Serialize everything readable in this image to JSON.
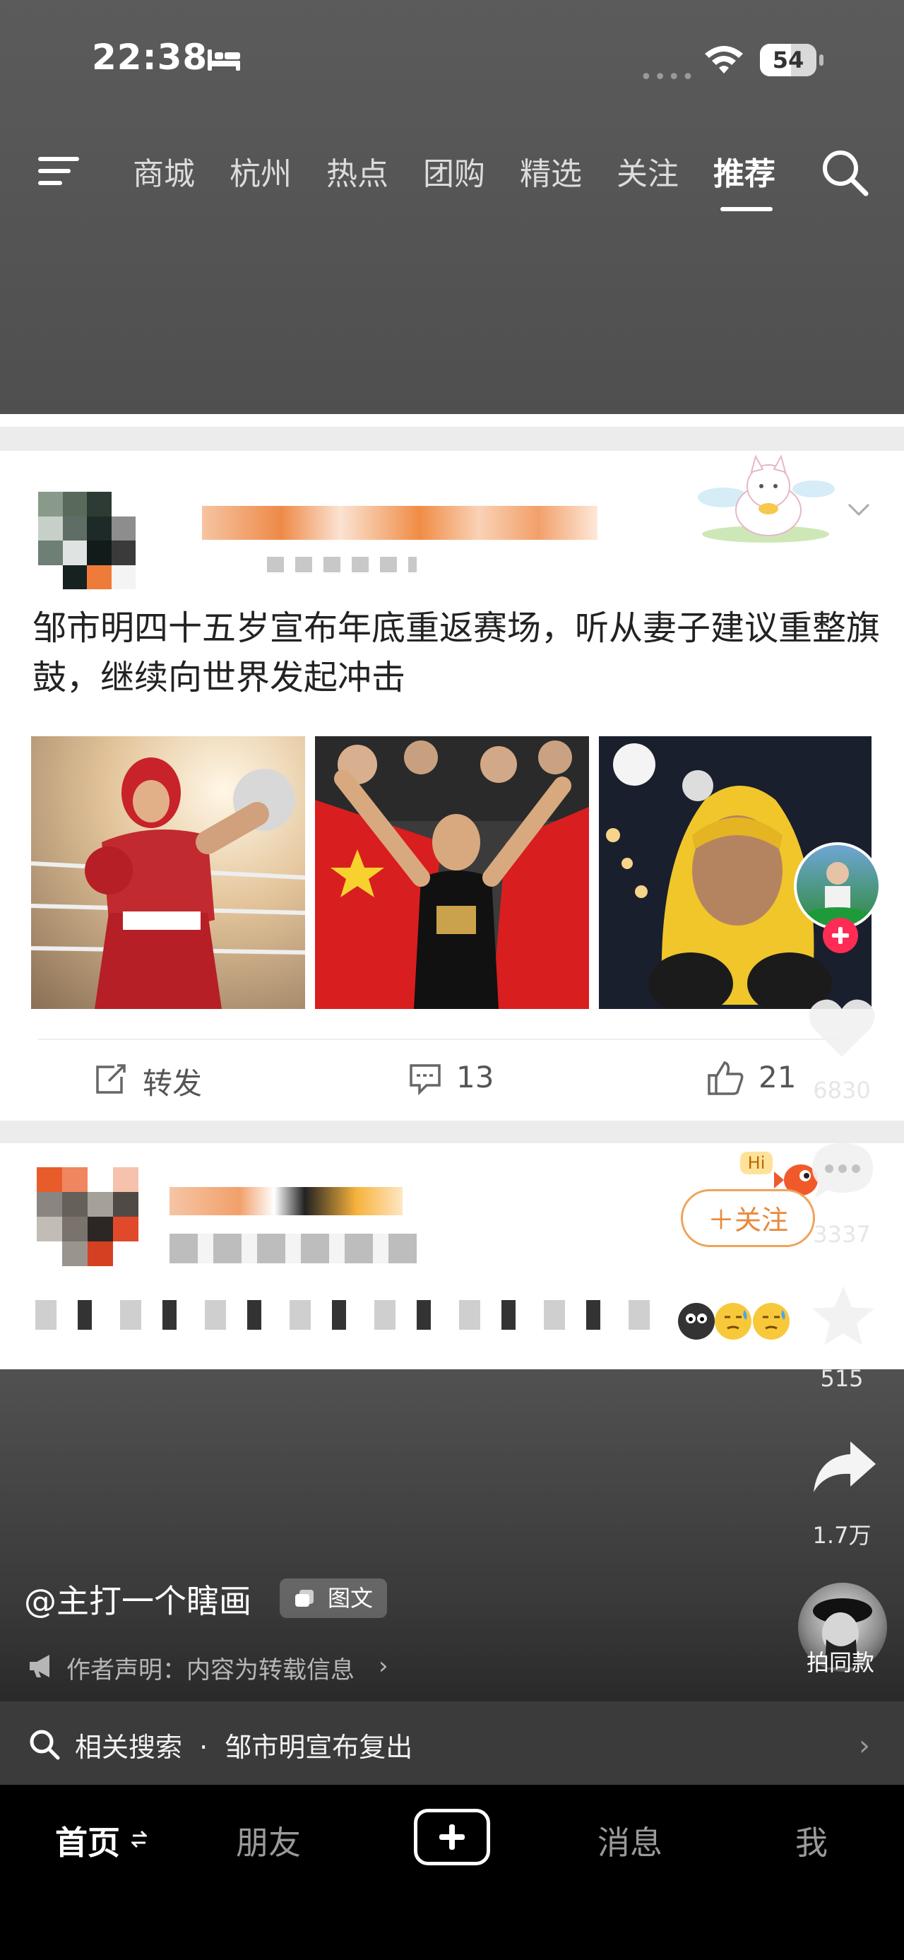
{
  "status_bar": {
    "time": "22:38",
    "signal": "••••",
    "battery": "54"
  },
  "top_nav": {
    "tabs": [
      "商城",
      "杭州",
      "热点",
      "团购",
      "精选",
      "关注",
      "推荐"
    ],
    "active_tab": "推荐"
  },
  "post1": {
    "text": "邹市明四十五岁宣布年底重返赛场，听从妻子建议重整旗鼓，继续向世界发起冲击",
    "actions": {
      "repost": "转发",
      "comments": "13",
      "likes": "21"
    }
  },
  "post2": {
    "follow": "＋关注",
    "hi": "Hi"
  },
  "rail": {
    "likes": "6830",
    "comments": "3337",
    "favorites": "515",
    "shares": "1.7万",
    "same_style": "拍同款"
  },
  "video_info": {
    "author": "@主打一个瞎画",
    "tag": "图文",
    "declaration": "作者声明：内容为转载信息"
  },
  "related": {
    "label": "相关搜索",
    "dot": "·",
    "query": "邹市明宣布复出"
  },
  "bottom_nav": {
    "home": "首页",
    "friends": "朋友",
    "messages": "消息",
    "me": "我"
  },
  "colors": {
    "accent_red": "#fe2c55",
    "follow_orange": "#e8893b",
    "flag_red": "#d81e1e"
  }
}
